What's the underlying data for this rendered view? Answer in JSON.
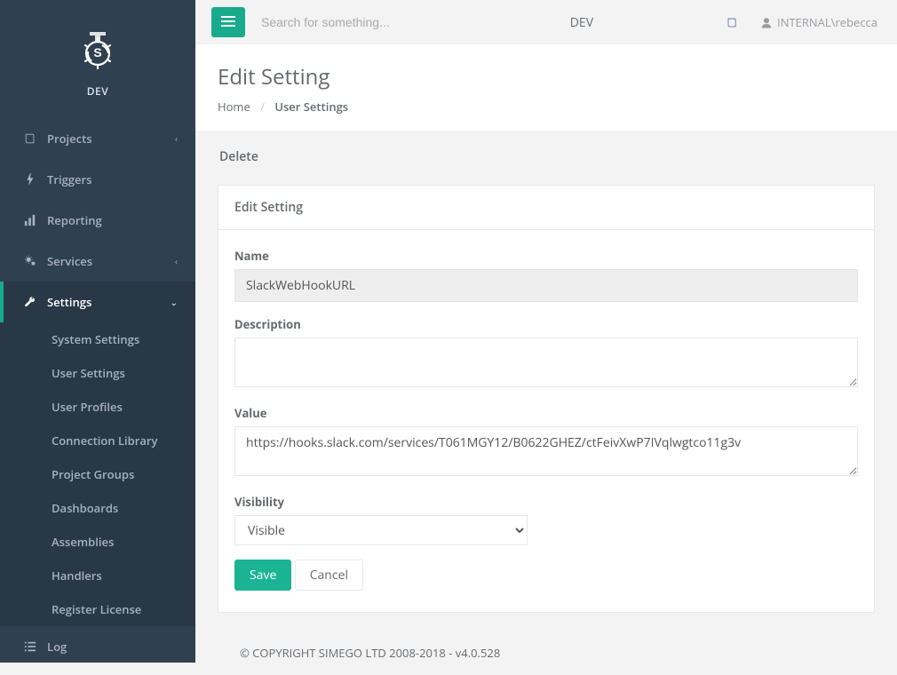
{
  "logo": {
    "label": "DEV"
  },
  "sidebar": {
    "items": [
      {
        "label": "Projects",
        "icon": "book",
        "hasSub": true,
        "expanded": false
      },
      {
        "label": "Triggers",
        "icon": "bolt",
        "hasSub": false
      },
      {
        "label": "Reporting",
        "icon": "bar-chart",
        "hasSub": false
      },
      {
        "label": "Services",
        "icon": "cogs",
        "hasSub": true,
        "expanded": false
      },
      {
        "label": "Settings",
        "icon": "wrench",
        "hasSub": true,
        "expanded": true,
        "sub": [
          "System Settings",
          "User Settings",
          "User Profiles",
          "Connection Library",
          "Project Groups",
          "Dashboards",
          "Assemblies",
          "Handlers",
          "Register License"
        ]
      },
      {
        "label": "Log",
        "icon": "list",
        "hasSub": false
      }
    ]
  },
  "topbar": {
    "search_placeholder": "Search for something...",
    "env": "DEV",
    "user_label": "INTERNAL\\rebecca"
  },
  "page": {
    "title": "Edit Setting",
    "breadcrumb": {
      "home": "Home",
      "active": "User Settings"
    },
    "delete_label": "Delete"
  },
  "panel": {
    "title": "Edit Setting"
  },
  "form": {
    "name_label": "Name",
    "name_value": "SlackWebHookURL",
    "description_label": "Description",
    "description_value": "",
    "value_label": "Value",
    "value_value": "https://hooks.slack.com/services/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",
    "visibility_label": "Visibility",
    "visibility_selected": "Visible",
    "save_label": "Save",
    "cancel_label": "Cancel"
  },
  "footer": {
    "copyright": "© COPYRIGHT SIMEGO LTD 2008-2018 - v4.0.528"
  }
}
